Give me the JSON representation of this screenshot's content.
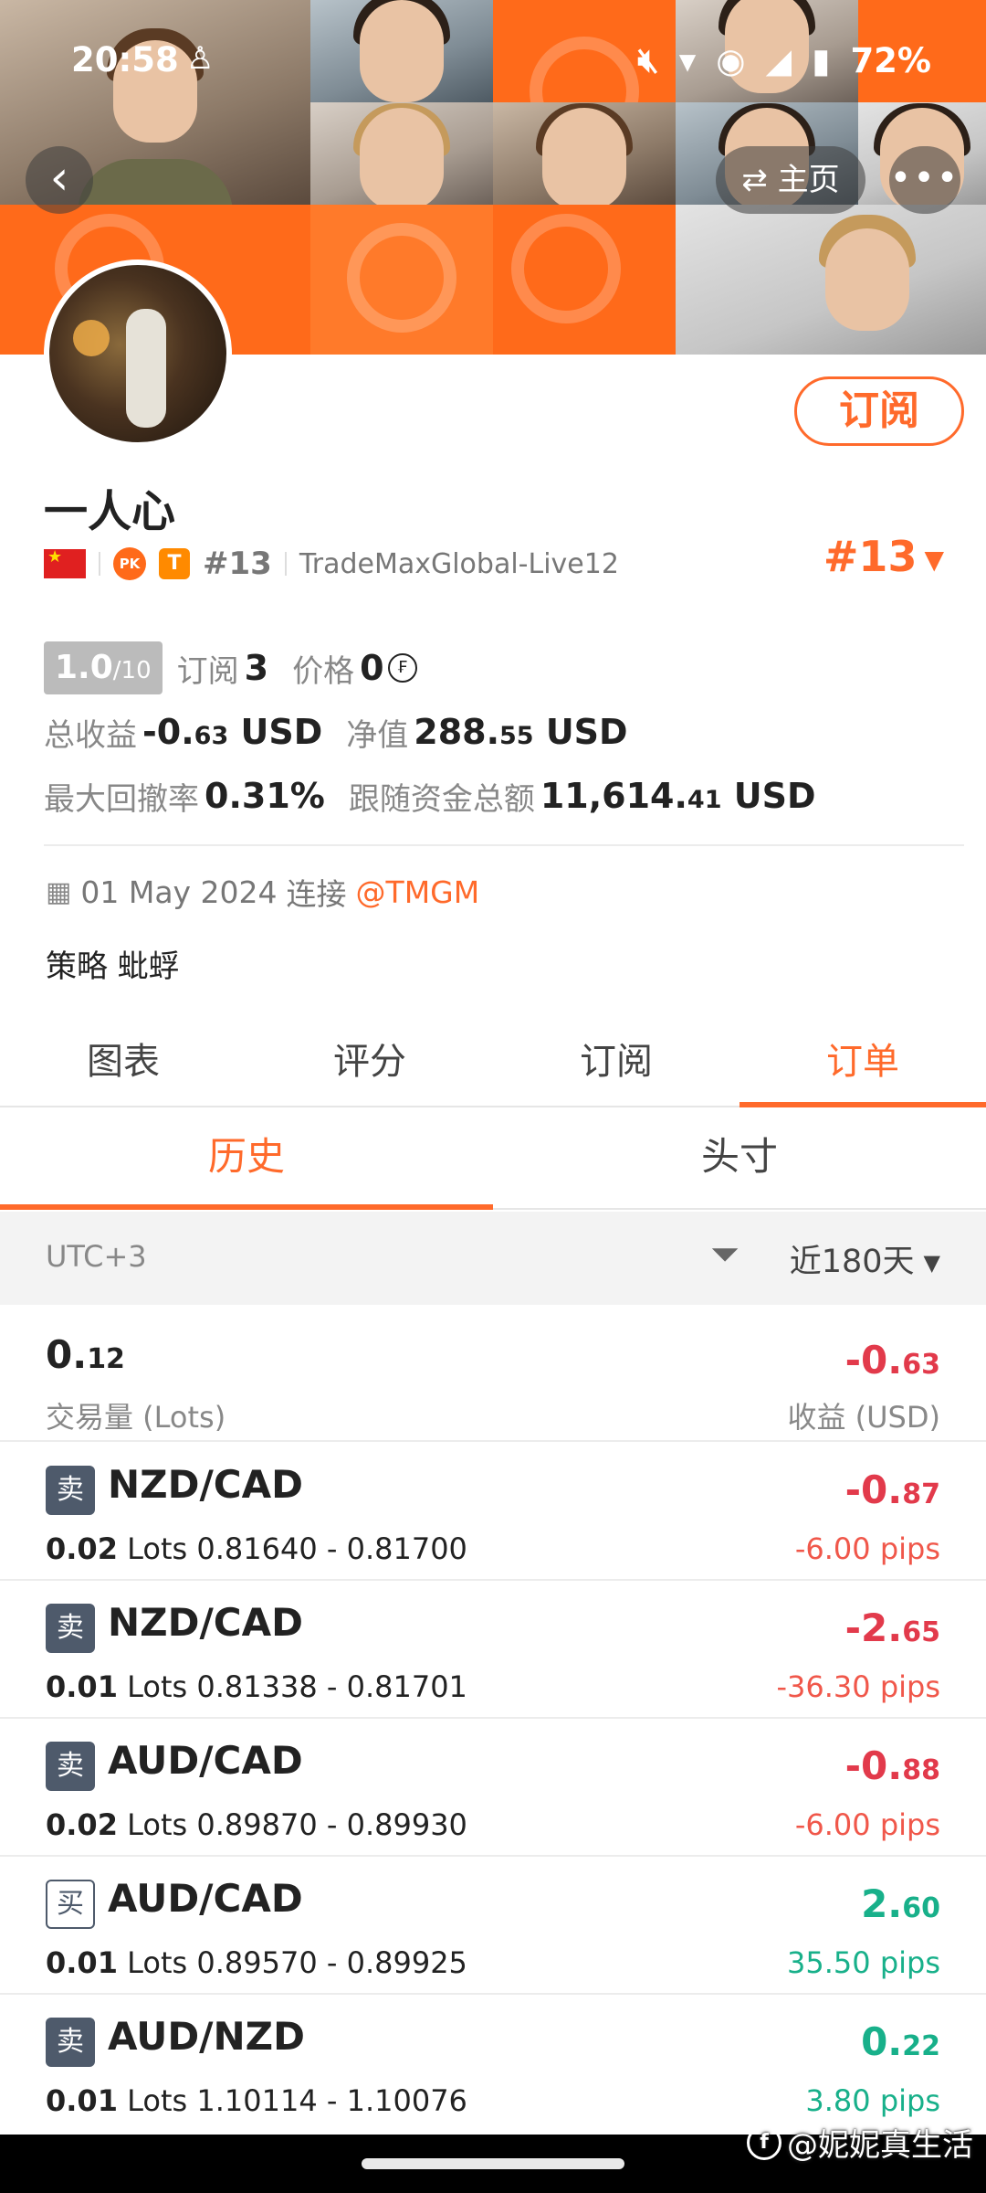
{
  "status_bar": {
    "time": "20:58",
    "battery": "72%",
    "notification_icon": "qq-penguin-icon",
    "icons": [
      "mute-icon",
      "wifi-icon",
      "hotspot-icon",
      "signal-icon",
      "battery-icon"
    ]
  },
  "header": {
    "back_icon": "chevron-left-icon",
    "home_label": "主页",
    "home_icon": "swap-icon",
    "more_icon": "more-icon"
  },
  "profile": {
    "name": "一人心",
    "rank": "#13",
    "rank_big": "#13",
    "server": "TradeMaxGlobal-Live12",
    "subscribe_label": "订阅",
    "badges": [
      "china-flag-icon",
      "pk-badge-icon",
      "t-badge-icon"
    ]
  },
  "stats": {
    "score": "1.0",
    "score_out_of": "/10",
    "subscribe_label": "订阅",
    "subscribe_count": "3",
    "price_label": "价格",
    "price_value": "0",
    "total_profit_label": "总收益",
    "total_profit_main": "-0.",
    "total_profit_dec": "63",
    "total_profit_unit": "USD",
    "equity_label": "净值",
    "equity_main": "288.",
    "equity_dec": "55",
    "equity_unit": "USD",
    "max_drawdown_label": "最大回撤率",
    "max_drawdown_value": "0.31%",
    "follow_funds_label": "跟随资金总额",
    "follow_funds_main": "11,614.",
    "follow_funds_dec": "41",
    "follow_funds_unit": "USD"
  },
  "connect": {
    "date": "01 May 2024",
    "text": "连接",
    "broker": "@TMGM"
  },
  "strategy": "策略 蚍蜉",
  "tabs": [
    {
      "label": "图表",
      "active": false
    },
    {
      "label": "评分",
      "active": false
    },
    {
      "label": "订阅",
      "active": false
    },
    {
      "label": "订单",
      "active": true
    }
  ],
  "subtabs": [
    {
      "label": "历史",
      "active": true
    },
    {
      "label": "头寸",
      "active": false
    }
  ],
  "filter": {
    "timezone": "UTC+3",
    "period": "近180天"
  },
  "summary": {
    "volume_main": "0.",
    "volume_dec": "12",
    "volume_label": "交易量 (Lots)",
    "profit_main": "-0.",
    "profit_dec": "63",
    "profit_label": "收益 (USD)"
  },
  "orders": [
    {
      "side": "卖",
      "pair": "NZD/CAD",
      "lots": "0.02",
      "lots_unit": "Lots",
      "range": "0.81640 - 0.81700",
      "pl_main": "-0.",
      "pl_dec": "87",
      "pips": "-6.00 pips",
      "positive": false
    },
    {
      "side": "卖",
      "pair": "NZD/CAD",
      "lots": "0.01",
      "lots_unit": "Lots",
      "range": "0.81338 - 0.81701",
      "pl_main": "-2.",
      "pl_dec": "65",
      "pips": "-36.30 pips",
      "positive": false
    },
    {
      "side": "卖",
      "pair": "AUD/CAD",
      "lots": "0.02",
      "lots_unit": "Lots",
      "range": "0.89870 - 0.89930",
      "pl_main": "-0.",
      "pl_dec": "88",
      "pips": "-6.00 pips",
      "positive": false
    },
    {
      "side": "买",
      "pair": "AUD/CAD",
      "lots": "0.01",
      "lots_unit": "Lots",
      "range": "0.89570 - 0.89925",
      "pl_main": "2.",
      "pl_dec": "60",
      "pips": "35.50 pips",
      "positive": true
    },
    {
      "side": "卖",
      "pair": "AUD/NZD",
      "lots": "0.01",
      "lots_unit": "Lots",
      "range": "1.10114 - 1.10076",
      "pl_main": "0.",
      "pl_dec": "22",
      "pips": "3.80 pips",
      "positive": true
    }
  ],
  "watermark": "@妮妮真生活",
  "colors": {
    "accent": "#ff6a2b",
    "negative": "#e23a4b",
    "positive": "#18b08a",
    "badge": "#4e5a6b"
  }
}
